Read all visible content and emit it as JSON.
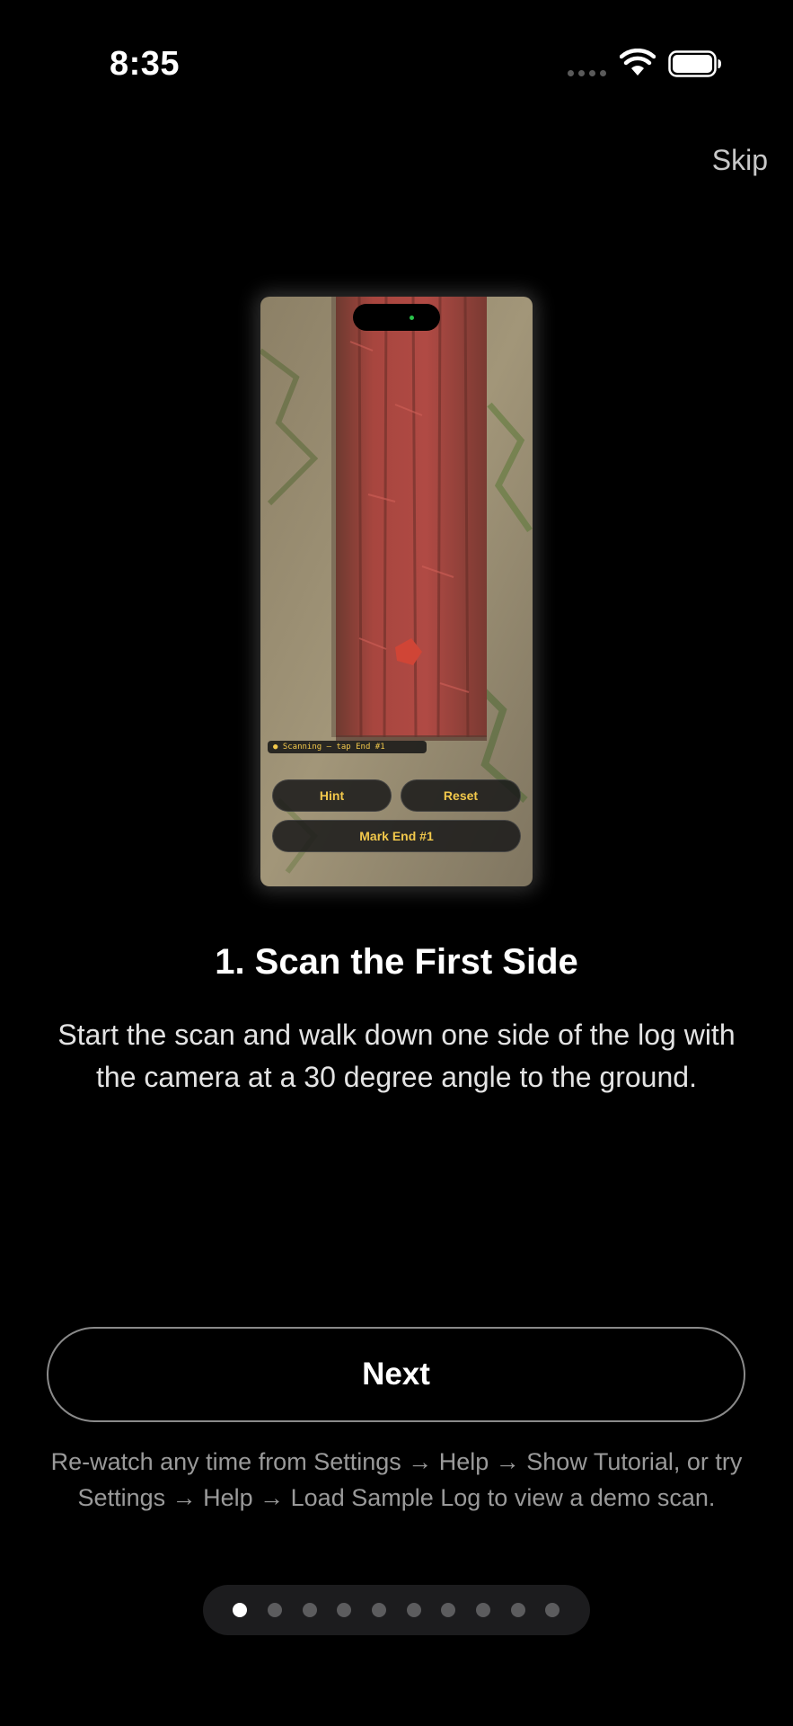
{
  "status_bar": {
    "time": "8:35",
    "icons": [
      "signal-dots-icon",
      "wifi-icon",
      "battery-icon"
    ]
  },
  "header": {
    "skip_label": "Skip"
  },
  "preview": {
    "island_indicator_color": "#29c24a",
    "scan_status": "● Scanning — tap End #1",
    "hint_label": "Hint",
    "reset_label": "Reset",
    "mark_end_label": "Mark End #1",
    "accent_color": "#f2c84b"
  },
  "content": {
    "title": "1. Scan the First Side",
    "body": "Start the scan and walk down one side of the log with the camera at a 30 degree angle to the ground."
  },
  "actions": {
    "next_label": "Next"
  },
  "footer": {
    "note": "Re-watch any time from Settings → Help → Show Tutorial, or try Settings → Help → Load Sample Log to view a demo scan."
  },
  "pager": {
    "total_pages": 10,
    "current_page": 1
  }
}
